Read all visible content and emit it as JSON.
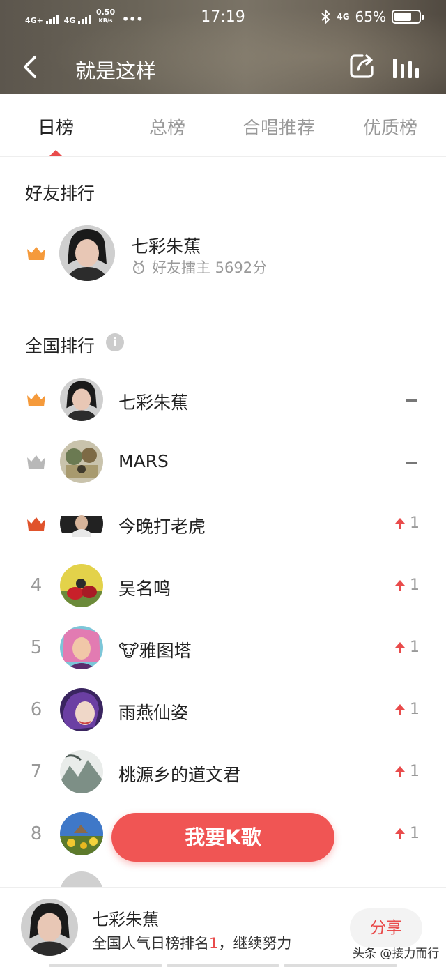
{
  "status_bar": {
    "network_left": "4G+",
    "network_left2": "4G",
    "speed": "0.50",
    "speed_unit": "KB/s",
    "dots": "•••",
    "time": "17:19",
    "network_right": "4G",
    "battery": "65%"
  },
  "nav": {
    "title": "就是这样"
  },
  "tabs": [
    {
      "label": "日榜",
      "active": true
    },
    {
      "label": "总榜",
      "active": false
    },
    {
      "label": "合唱推荐",
      "active": false
    },
    {
      "label": "优质榜",
      "active": false
    }
  ],
  "friends": {
    "title": "好友排行",
    "top": {
      "name": "七彩朱蕉",
      "subtitle": "好友擂主 5692分"
    }
  },
  "national": {
    "title": "全国排行",
    "info_glyph": "i",
    "rows": [
      {
        "rank": "",
        "crown": "gold",
        "name": "七彩朱蕉",
        "trend": "flat",
        "change": ""
      },
      {
        "rank": "",
        "crown": "silver",
        "name": "MARS",
        "trend": "flat",
        "change": ""
      },
      {
        "rank": "",
        "crown": "bronze",
        "name": "今晚打老虎",
        "trend": "up",
        "change": "1"
      },
      {
        "rank": "4",
        "crown": "",
        "name": "吴名鸣",
        "trend": "up",
        "change": "1"
      },
      {
        "rank": "5",
        "crown": "",
        "name": "🐮雅图塔",
        "trend": "up",
        "change": "1"
      },
      {
        "rank": "6",
        "crown": "",
        "name": "雨燕仙姿",
        "trend": "up",
        "change": "1"
      },
      {
        "rank": "7",
        "crown": "",
        "name": "桃源乡的道文君",
        "trend": "up",
        "change": "1"
      },
      {
        "rank": "8",
        "crown": "",
        "name": "",
        "trend": "up",
        "change": "1"
      }
    ]
  },
  "ksong_button": "我要K歌",
  "bottom": {
    "name": "七彩朱蕉",
    "rank_prefix": "全国人气日榜排名",
    "rank_value": "1",
    "rank_suffix": "，继续努力",
    "share_label": "分享",
    "watermark": "头条 @接力而行"
  },
  "colors": {
    "accent": "#e94b4b",
    "button": "#f05554",
    "gold_crown": "#f59a3b",
    "silver_crown": "#b8b8b8",
    "bronze_crown": "#e0532c"
  }
}
